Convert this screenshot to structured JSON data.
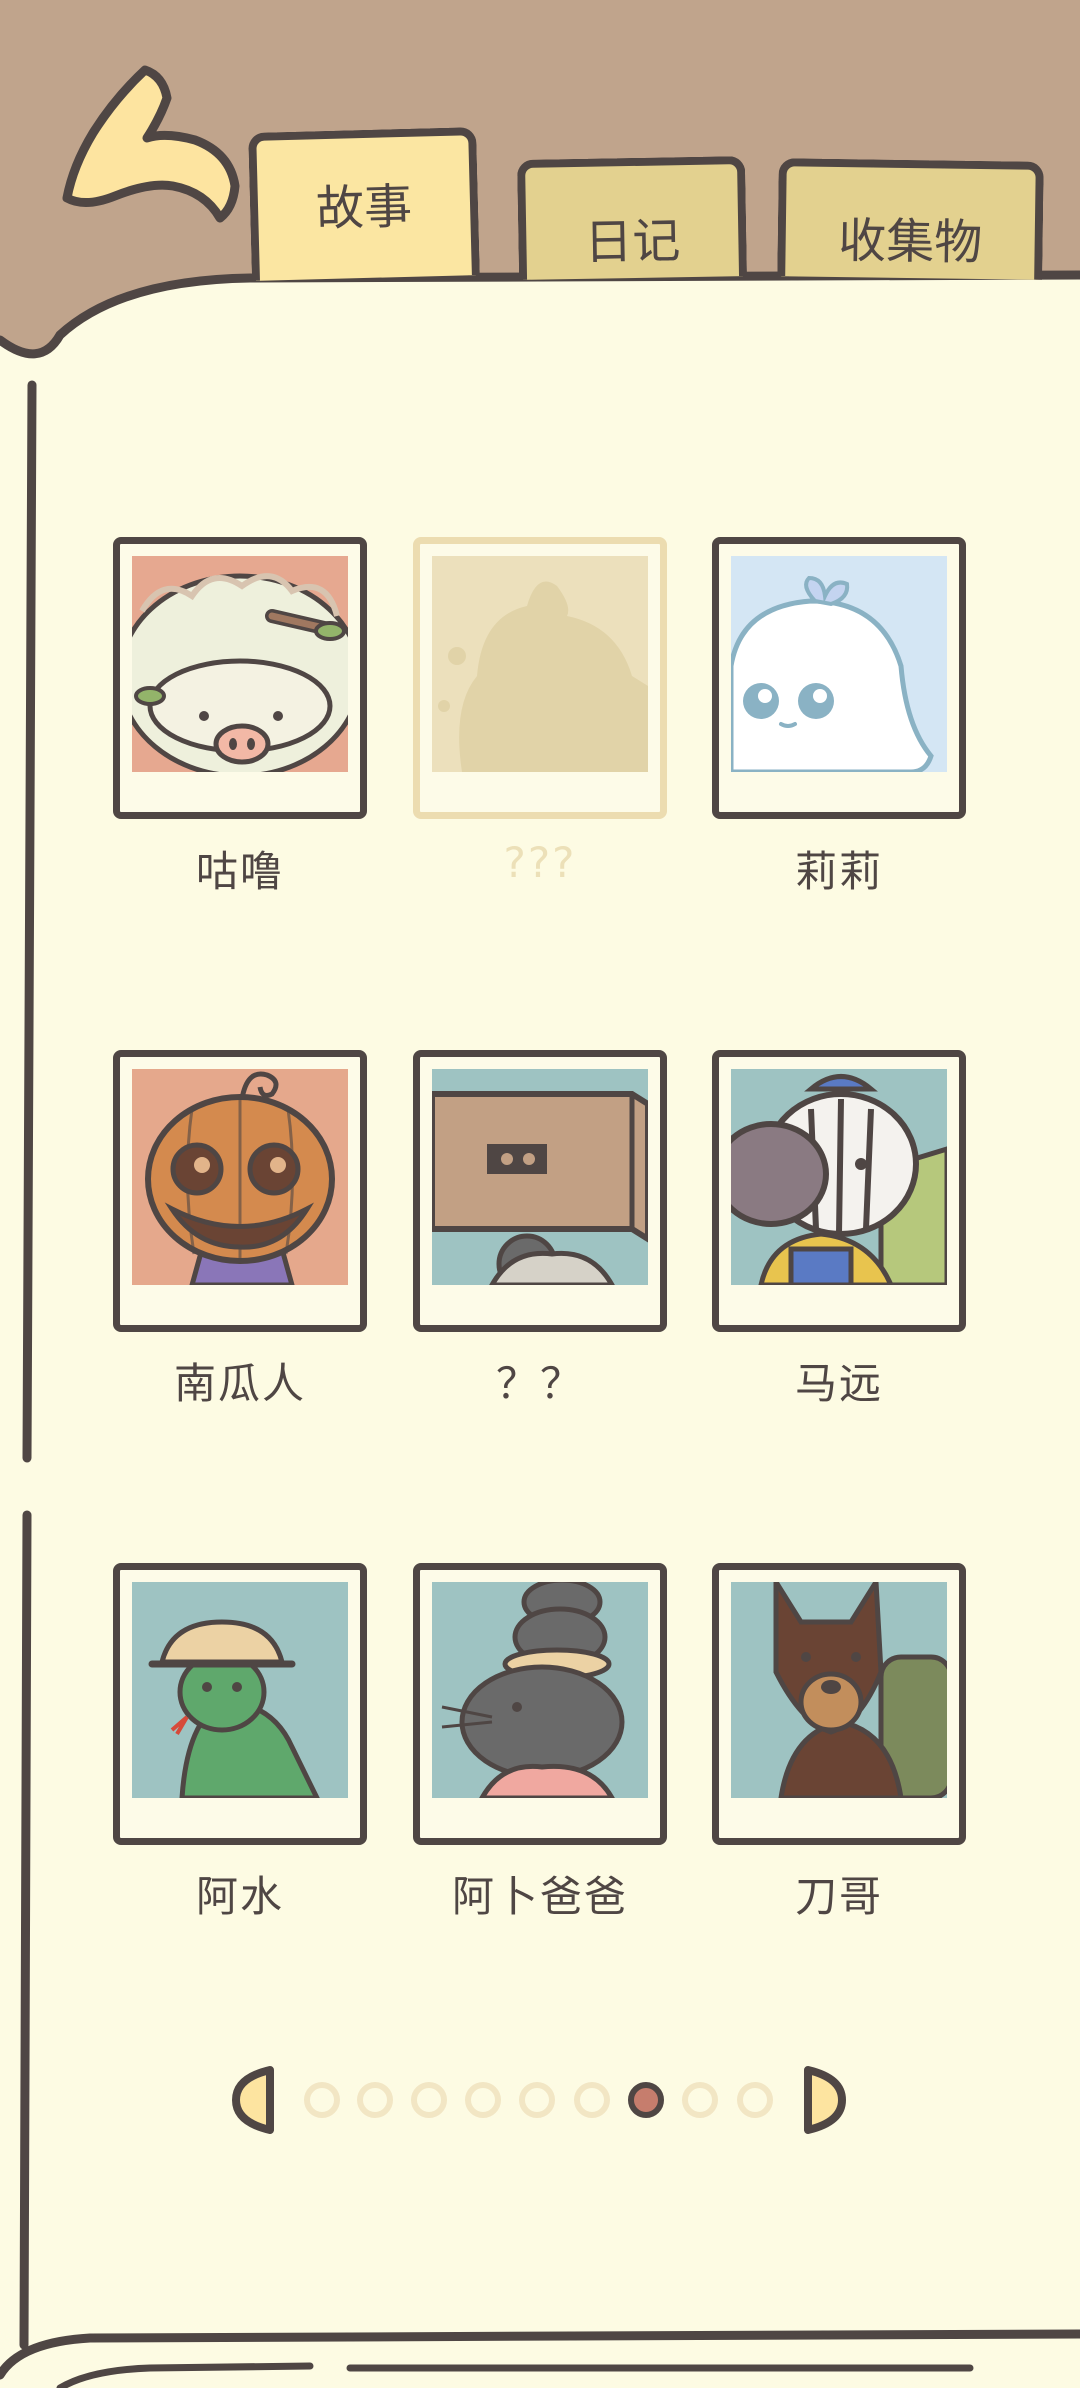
{
  "tabs": {
    "story": "故事",
    "diary": "日记",
    "collection": "收集物"
  },
  "characters": [
    {
      "name": "咕噜",
      "locked": false
    },
    {
      "name": "???",
      "locked": true
    },
    {
      "name": "莉莉",
      "locked": false
    },
    {
      "name": "南瓜人",
      "locked": false
    },
    {
      "name": "？？",
      "locked": false
    },
    {
      "name": "马远",
      "locked": false
    },
    {
      "name": "阿水",
      "locked": false
    },
    {
      "name": "阿卜爸爸",
      "locked": false
    },
    {
      "name": "刀哥",
      "locked": false
    }
  ],
  "pagination": {
    "current_page": 7,
    "total_pages": 9
  },
  "colors": {
    "outline": "#4f4644",
    "book_page": "#fdfbe3",
    "desk_brown": "#c0a48c",
    "active_tab": "#fbe6a2",
    "inactive_tab": "#e3d18f",
    "active_dot": "#c67d6d"
  }
}
